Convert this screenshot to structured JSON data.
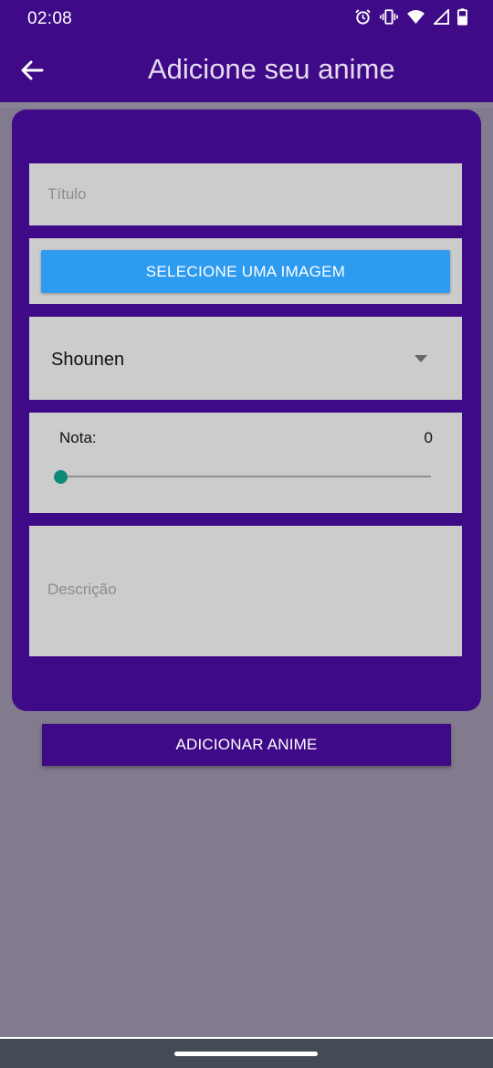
{
  "status_bar": {
    "time": "02:08",
    "icons": [
      "alarm-icon",
      "vibrate-icon",
      "wifi-icon",
      "signal-icon",
      "battery-icon"
    ]
  },
  "app_bar": {
    "title": "Adicione seu anime",
    "back_icon": "arrow-back-icon"
  },
  "form": {
    "title_placeholder": "Título",
    "select_image_label": "SELECIONE UMA IMAGEM",
    "genre_value": "Shounen",
    "rating_label": "Nota:",
    "rating_value": "0",
    "rating_fraction": 0,
    "description_placeholder": "Descrição"
  },
  "submit_label": "ADICIONAR ANIME",
  "colors": {
    "primary": "#3f0a87",
    "accent_button": "#2d9bf0",
    "slider_thumb": "#0d8a7a",
    "field_background": "#cccccc",
    "page_scrim": "#827a8d"
  }
}
